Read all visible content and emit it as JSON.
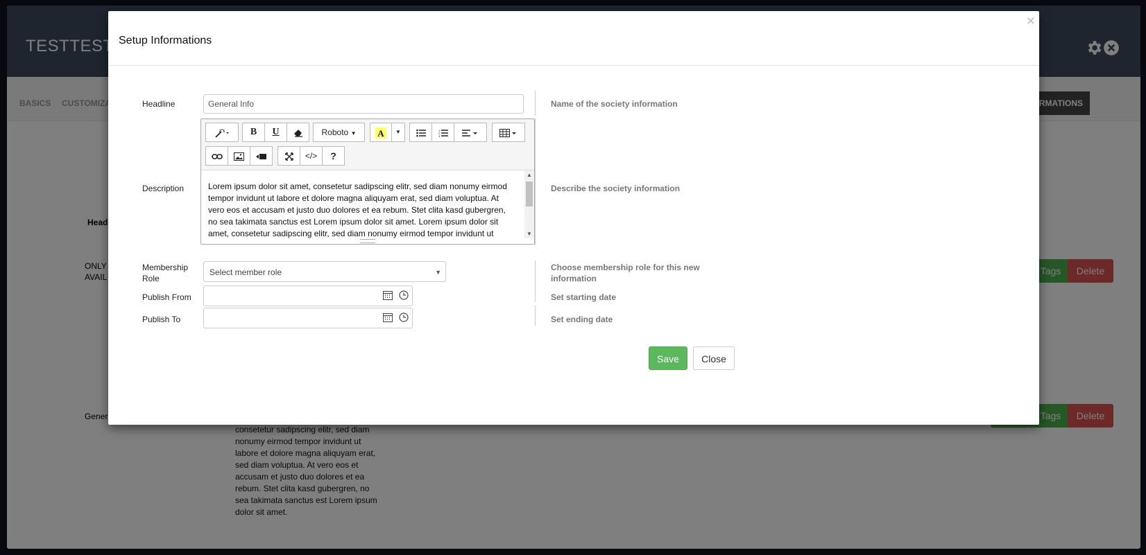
{
  "background": {
    "app_title": "TESTTEST",
    "nav": {
      "basics": "BASICS",
      "customize": "CUSTOMIZA",
      "informations": "RMATIONS"
    },
    "table_header": "Head",
    "row1_label": "ONLY I\nAVAIL",
    "row2_label": "Genera",
    "tags_label": "Tags",
    "delete_label": "Delete",
    "row2_description": "consetetur sadipscing elitr, sed diam nonumy eirmod tempor invidunt ut labore et dolore magna aliquyam erat, sed diam voluptua. At vero eos et accusam et justo duo dolores et ea rebum. Stet clita kasd gubergren, no sea takimata sanctus est Lorem ipsum dolor sit amet."
  },
  "modal": {
    "title": "Setup Informations",
    "close_glyph": "×",
    "headline": {
      "label": "Headline",
      "value": "General Info",
      "help": "Name of the society information"
    },
    "description": {
      "label": "Description",
      "help": "Describe the society information",
      "text": "Lorem ipsum dolor sit amet, consetetur sadipscing elitr, sed diam nonumy eirmod tempor invidunt ut labore et dolore magna aliquyam erat, sed diam voluptua. At vero eos et accusam et justo duo dolores et ea rebum. Stet clita kasd gubergren, no sea takimata sanctus est Lorem ipsum dolor sit amet. Lorem ipsum dolor sit amet, consetetur sadipscing elitr, sed diam nonumy eirmod tempor invidunt ut"
    },
    "toolbar": {
      "font_name": "Roboto",
      "bold": "B",
      "underline": "U",
      "code": "</>",
      "help": "?"
    },
    "membership": {
      "label": "Membership Role",
      "placeholder": "Select member role",
      "help": "Choose membership role for this new information"
    },
    "publish_from": {
      "label": "Publish From",
      "help": "Set starting date"
    },
    "publish_to": {
      "label": "Publish To",
      "help": "Set ending date"
    },
    "save_label": "Save",
    "close_label": "Close"
  },
  "colors": {
    "save": "#5cb85c",
    "delete": "#d9534f",
    "header": "#3d4a5c"
  }
}
